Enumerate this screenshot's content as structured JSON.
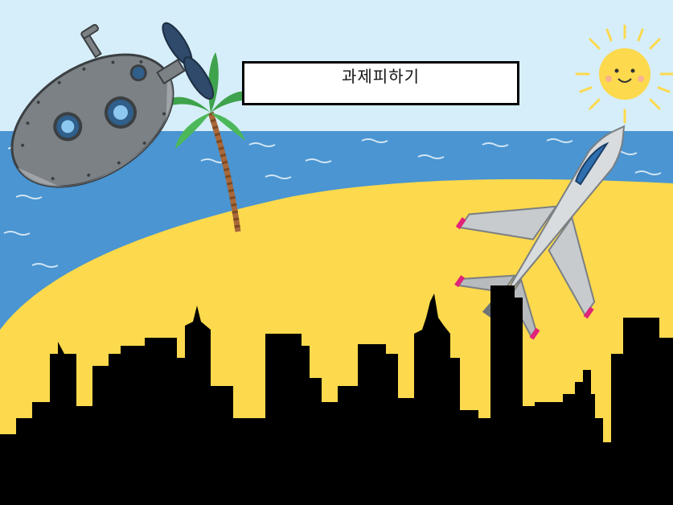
{
  "game": {
    "title": "과제피하기"
  },
  "scene": {
    "sky_color": "#d6eefa",
    "sea_color": "#4a95d2",
    "sand_color": "#fcd94d",
    "skyline_color": "#000000"
  },
  "sprites": {
    "submarine": "submarine-icon",
    "palm": "palm-tree-icon",
    "sun": "smiling-sun-icon",
    "jet": "fighter-jet-icon"
  }
}
